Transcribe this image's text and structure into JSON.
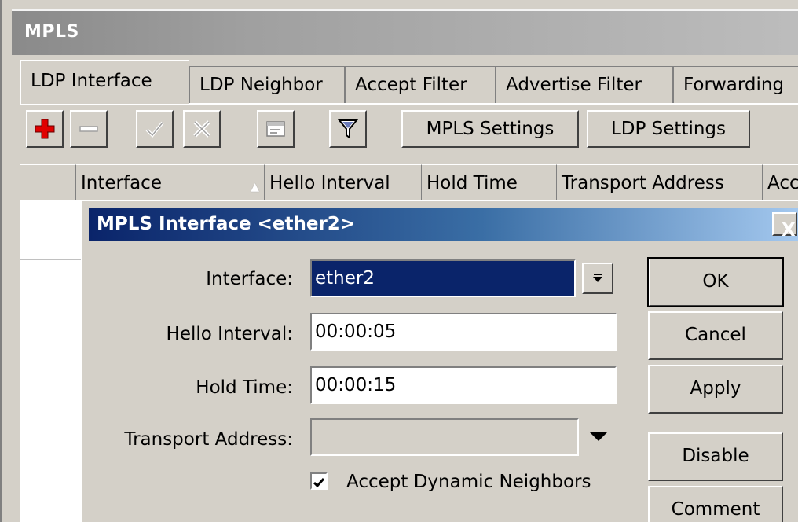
{
  "window": {
    "title": "MPLS"
  },
  "tabs": [
    {
      "label": "LDP Interface",
      "active": true
    },
    {
      "label": "LDP Neighbor"
    },
    {
      "label": "Accept Filter"
    },
    {
      "label": "Advertise Filter"
    },
    {
      "label": "Forwarding"
    }
  ],
  "toolbar": {
    "icons": [
      "add-icon",
      "remove-icon",
      "enable-icon",
      "disable-icon",
      "comment-icon",
      "filter-icon"
    ],
    "mpls_settings_label": "MPLS Settings",
    "ldp_settings_label": "LDP Settings"
  },
  "grid": {
    "columns": [
      "Interface",
      "Hello Interval",
      "Hold Time",
      "Transport Address",
      "Acc"
    ],
    "sort_indicator": "▲"
  },
  "dialog": {
    "title": "MPLS Interface <ether2>",
    "close_label": "X",
    "fields": {
      "interface": {
        "label": "Interface:",
        "value": "ether2"
      },
      "hello_interval": {
        "label": "Hello Interval:",
        "value": "00:00:05"
      },
      "hold_time": {
        "label": "Hold Time:",
        "value": "00:00:15"
      },
      "transport_address": {
        "label": "Transport Address:",
        "value": ""
      }
    },
    "accept_dynamic_neighbors": {
      "label": "Accept Dynamic Neighbors",
      "checked": true
    },
    "buttons": {
      "ok": "OK",
      "cancel": "Cancel",
      "apply": "Apply",
      "disable": "Disable",
      "comment": "Comment"
    }
  },
  "colors": {
    "window_bg": "#d4d0c8",
    "dialog_title_start": "#0a246a",
    "dialog_title_end": "#a6caf0",
    "selection": "#0a246a",
    "add_icon": "#e00000"
  }
}
